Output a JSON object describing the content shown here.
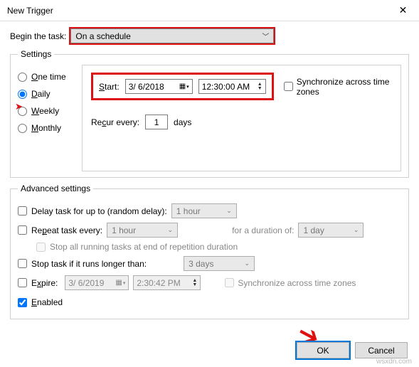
{
  "window": {
    "title": "New Trigger",
    "close_glyph": "✕"
  },
  "begin": {
    "label": "Begin the task:",
    "value": "On a schedule"
  },
  "settings": {
    "legend": "Settings",
    "freq": {
      "one_time": "One time",
      "daily": "Daily",
      "weekly": "Weekly",
      "monthly": "Monthly",
      "selected": "daily"
    },
    "start_label": "Start:",
    "date": "3/ 6/2018",
    "time": "12:30:00 AM",
    "sync_label": "Synchronize across time zones",
    "recur_label": "Recur every:",
    "recur_value": "1",
    "recur_unit": "days"
  },
  "advanced": {
    "legend": "Advanced settings",
    "delay_label": "Delay task for up to (random delay):",
    "delay_value": "1 hour",
    "repeat_label": "Repeat task every:",
    "repeat_value": "1 hour",
    "duration_label": "for a duration of:",
    "duration_value": "1 day",
    "stop_all_label": "Stop all running tasks at end of repetition duration",
    "stop_if_label": "Stop task if it runs longer than:",
    "stop_if_value": "3 days",
    "expire_label": "Expire:",
    "expire_date": "3/ 6/2019",
    "expire_time": "2:30:42 PM",
    "sync2_label": "Synchronize across time zones",
    "enabled_label": "Enabled"
  },
  "buttons": {
    "ok": "OK",
    "cancel": "Cancel"
  },
  "watermark": "wsxdn.com"
}
